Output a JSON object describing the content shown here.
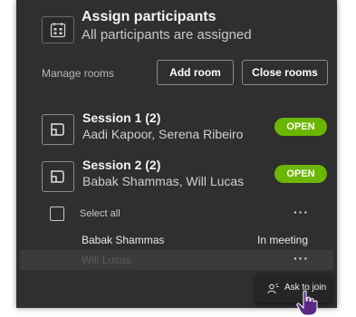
{
  "assign": {
    "title": "Assign participants",
    "subtitle": "All participants are assigned",
    "icon": "assign-participants-icon"
  },
  "manage": {
    "label": "Manage rooms",
    "add_room": "Add room",
    "close_rooms": "Close rooms"
  },
  "rooms": [
    {
      "name": "Session 1 (2)",
      "participants": "Aadi Kapoor, Serena Ribeiro",
      "status": "OPEN",
      "icon": "breakout-room-icon"
    },
    {
      "name": "Session 2 (2)",
      "participants": "Babak Shammas, Will Lucas",
      "status": "OPEN",
      "icon": "breakout-room-icon"
    }
  ],
  "select_all": {
    "label": "Select all",
    "more": "···"
  },
  "participants": [
    {
      "name": "Babak Shammas",
      "status": "In meeting"
    },
    {
      "name": "Will Lucas",
      "more": "···"
    }
  ],
  "context_menu": {
    "label": "Ask to join",
    "icon": "ask-to-join-icon"
  },
  "colors": {
    "panel_bg": "#2f2f2f",
    "open_badge": "#6bb700",
    "cursor": "#5b2a86"
  }
}
